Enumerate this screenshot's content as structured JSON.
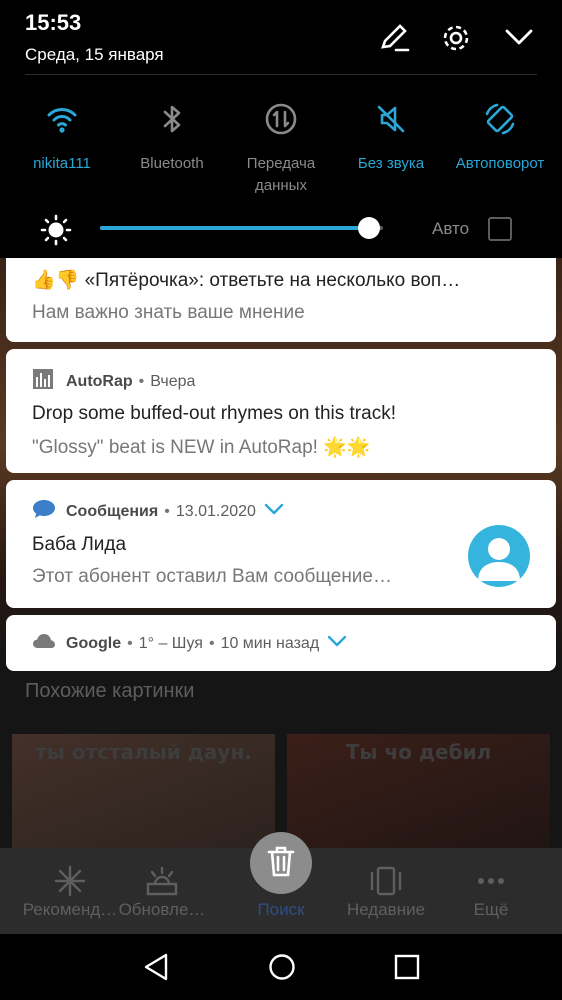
{
  "status": {
    "time": "15:53",
    "date": "Среда, 15 января"
  },
  "colors": {
    "accent": "#2aa7d6",
    "active_tab": "#2f4d86"
  },
  "quick_settings": [
    {
      "label": "nikita111",
      "icon": "wifi-icon",
      "on": true
    },
    {
      "label": "Bluetooth",
      "icon": "bluetooth-icon",
      "on": false
    },
    {
      "label": "Передача данных",
      "icon": "mobile-data-icon",
      "on": false
    },
    {
      "label": "Без звука",
      "icon": "mute-icon",
      "on": true
    },
    {
      "label": "Автоповорот",
      "icon": "auto-rotate-icon",
      "on": true
    }
  ],
  "brightness": {
    "level": 0.95,
    "auto_label": "Авто",
    "auto_checked": false
  },
  "notifications": {
    "pyaterochka": {
      "title": "👍👎 «Пятёрочка»: ответьте на несколько воп…",
      "text": "Нам важно знать ваше мнение"
    },
    "autorap": {
      "app": "AutoRap",
      "time": "Вчера",
      "title": "Drop some buffed-out rhymes on this track!",
      "text": "\"Glossy\" beat is NEW in AutoRap! 🌟🌟"
    },
    "messages": {
      "app": "Сообщения",
      "time": "13.01.2020",
      "title": "Баба Лида",
      "text": "Этот абонент оставил Вам сообщение…"
    },
    "google": {
      "app": "Google",
      "weather": "1° – Шуя",
      "time": "10 мин назад"
    }
  },
  "background_app": {
    "similar_title": "Похожие картинки",
    "thumb_captions": [
      "ты отсталый даун.",
      "Ты чо дебил"
    ],
    "tabs": [
      "Рекоменд…",
      "Обновле…",
      "Поиск",
      "Недавние",
      "Ещё"
    ],
    "active_tab": "Поиск"
  }
}
